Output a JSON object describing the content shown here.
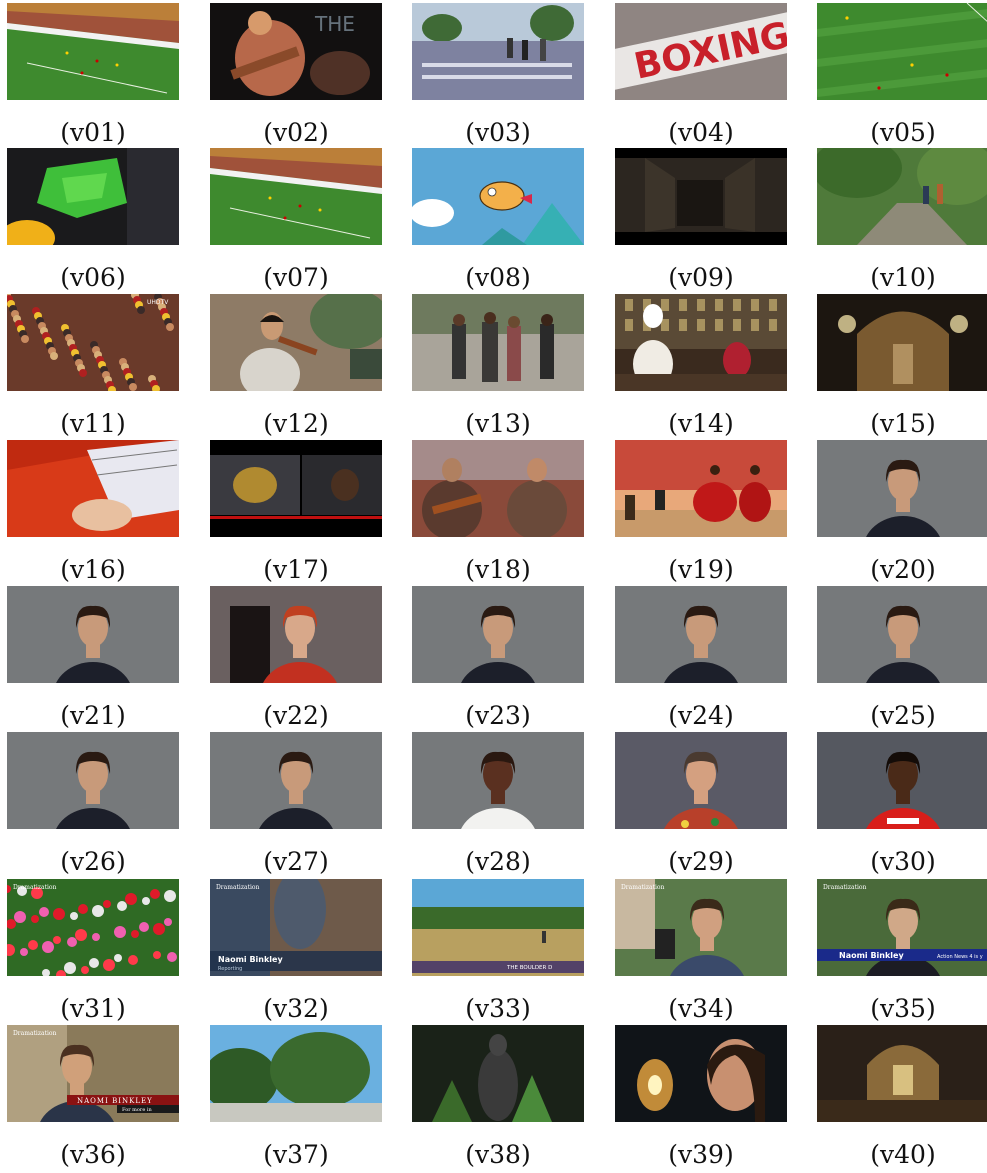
{
  "cells": [
    {
      "caption": "(v01)",
      "scene": "soccer-stadium-wide"
    },
    {
      "caption": "(v02)",
      "scene": "guitar-performer-stage"
    },
    {
      "caption": "(v03)",
      "scene": "street-crosswalk"
    },
    {
      "caption": "(v04)",
      "scene": "boxing-sign-blur",
      "overlay_text": "BOXING"
    },
    {
      "caption": "(v05)",
      "scene": "soccer-pitch-players"
    },
    {
      "caption": "(v06)",
      "scene": "green-fabric-closeup"
    },
    {
      "caption": "(v07)",
      "scene": "soccer-stadium-wide"
    },
    {
      "caption": "(v08)",
      "scene": "cartoon-flying-character"
    },
    {
      "caption": "(v09)",
      "scene": "dark-alley"
    },
    {
      "caption": "(v10)",
      "scene": "forest-path-people"
    },
    {
      "caption": "(v11)",
      "scene": "stadium-crowd",
      "overlay_text": "UHDTV"
    },
    {
      "caption": "(v12)",
      "scene": "violinist-outdoors"
    },
    {
      "caption": "(v13)",
      "scene": "pedestrians-sidewalk"
    },
    {
      "caption": "(v14)",
      "scene": "chef-kitchen"
    },
    {
      "caption": "(v15)",
      "scene": "church-interior"
    },
    {
      "caption": "(v16)",
      "scene": "electric-guitar-closeup"
    },
    {
      "caption": "(v17)",
      "scene": "split-screen-dark"
    },
    {
      "caption": "(v18)",
      "scene": "guitarists-double"
    },
    {
      "caption": "(v19)",
      "scene": "flamenco-dance"
    },
    {
      "caption": "(v20)",
      "scene": "interview-gray-backdrop"
    },
    {
      "caption": "(v21)",
      "scene": "interview-gray-backdrop"
    },
    {
      "caption": "(v22)",
      "scene": "interview-red-hair"
    },
    {
      "caption": "(v23)",
      "scene": "interview-gray-backdrop"
    },
    {
      "caption": "(v24)",
      "scene": "interview-gray-backdrop"
    },
    {
      "caption": "(v25)",
      "scene": "interview-gray-backdrop"
    },
    {
      "caption": "(v26)",
      "scene": "interview-gray-backdrop"
    },
    {
      "caption": "(v27)",
      "scene": "interview-gray-backdrop"
    },
    {
      "caption": "(v28)",
      "scene": "interview-white-shirt"
    },
    {
      "caption": "(v29)",
      "scene": "interview-hawaiian-shirt"
    },
    {
      "caption": "(v30)",
      "scene": "interview-red-jersey"
    },
    {
      "caption": "(v31)",
      "scene": "red-pink-flowers",
      "overlay_text": "Dramatization"
    },
    {
      "caption": "(v32)",
      "scene": "news-lower-third",
      "overlay_text": "Dramatization",
      "lower_third_name": "Naomi Binkley",
      "lower_third_sub": "Reporting"
    },
    {
      "caption": "(v33)",
      "scene": "park-field",
      "lower_third_name": "THE BOULDER D"
    },
    {
      "caption": "(v34)",
      "scene": "reporter-outdoors",
      "overlay_text": "Dramatization"
    },
    {
      "caption": "(v35)",
      "scene": "news-lower-third-blue",
      "overlay_text": "Dramatization",
      "lower_third_name": "Naomi Binkley",
      "lower_third_sub": "Action News 4 is y"
    },
    {
      "caption": "(v36)",
      "scene": "news-lower-third-red",
      "overlay_text": "Dramatization",
      "lower_third_name": "NAOMI BINKLEY",
      "lower_third_sub": "For more in"
    },
    {
      "caption": "(v37)",
      "scene": "trees-sky"
    },
    {
      "caption": "(v38)",
      "scene": "garden-statue"
    },
    {
      "caption": "(v39)",
      "scene": "woman-lantern"
    },
    {
      "caption": "(v40)",
      "scene": "church-altar"
    }
  ],
  "colors": {
    "pitch": "#3e8a2e",
    "gray_backdrop": "#6f7274",
    "sky": "#5ba7d6",
    "news_blue": "#1a2a8a",
    "news_red": "#8a1212"
  }
}
